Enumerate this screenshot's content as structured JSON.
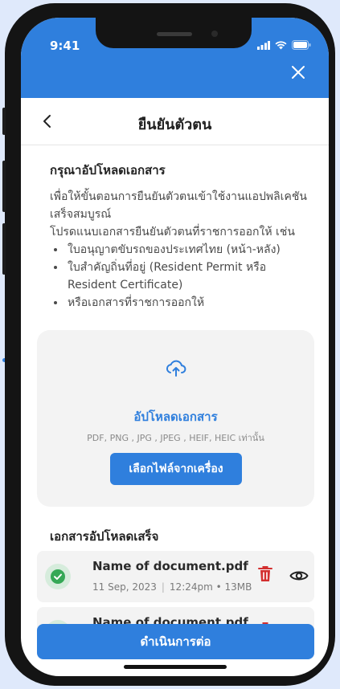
{
  "status_bar": {
    "time": "9:41"
  },
  "header": {
    "title": "ยืนยันตัวตน"
  },
  "instructions": {
    "heading": "กรุณาอัปโหลดเอกสาร",
    "intro": "เพื่อให้ขั้นตอนการยืนยันตัวตนเข้าใช้งานแอปพลิเคชันเสร็จสมบูรณ์",
    "lead": "โปรดแนบเอกสารยืนยันตัวตนที่ราชการออกให้ เช่น",
    "items": [
      "ใบอนุญาตขับรถของประเทศไทย (หน้า-หลัง)",
      "ใบสำคัญถิ่นที่อยู่ (Resident Permit หรือ Resident Certificate)",
      "หรือเอกสารที่ราชการออกให้"
    ]
  },
  "upload": {
    "title": "อัปโหลดเอกสาร",
    "formats": "PDF, PNG , JPG , JPEG , HEIF, HEIC เท่านั้น",
    "button": "เลือกไฟล์จากเครื่อง",
    "icon": "cloud-upload-icon"
  },
  "uploaded": {
    "title": "เอกสารอัปโหลดเสร็จ",
    "files": [
      {
        "name": "Name of document.pdf",
        "date": "11 Sep, 2023",
        "time": "12:24pm • 13MB"
      },
      {
        "name": "Name of document.pdf",
        "date": "",
        "time": ""
      }
    ]
  },
  "footer": {
    "continue": "ดำเนินการต่อ"
  },
  "colors": {
    "primary": "#2f7fdd",
    "success": "#35a856",
    "danger": "#d32f2f"
  }
}
